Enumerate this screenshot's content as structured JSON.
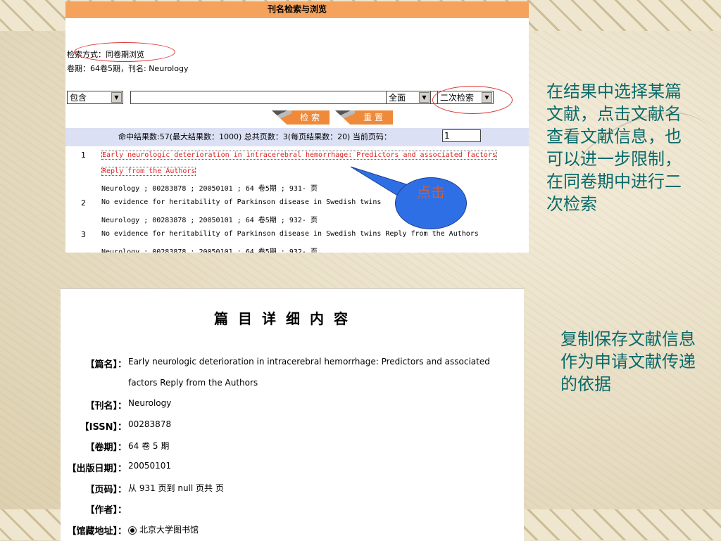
{
  "top_panel": {
    "title": "刊名检索与浏览",
    "search_mode": "检索方式：同卷期浏览",
    "volume_info": "卷期：64卷5期，刊名: Neurology",
    "match_select": "包含",
    "scope_select": "全面",
    "secondary_select": "二次检索",
    "search_button": "检 索",
    "reset_button": "重 置",
    "stats_text": "命中结果数:57(最大结果数：1000)   总共页数：3(每页结果数：20)  当前页码：",
    "page_value": "1",
    "results": [
      {
        "num": "1",
        "title_line1": "Early neurologic deterioration in intracerebral hemorrhage: Predictors and associated factors",
        "title_line2": "Reply from the Authors",
        "meta": "Neurology ; 00283878 ; 20050101 ; 64 卷5期 ; 931- 页"
      },
      {
        "num": "2",
        "title_line1": "No evidence for heritability of Parkinson disease in Swedish twins",
        "meta": "Neurology ; 00283878 ; 20050101 ; 64 卷5期 ; 932- 页"
      },
      {
        "num": "3",
        "title_line1": "No evidence for heritability of Parkinson disease in Swedish twins Reply from the Authors",
        "meta": "Neurology ; 00283878 ; 20050101 ; 64 卷5期 ; 932- 页"
      }
    ],
    "callout_text": "点击"
  },
  "detail_panel": {
    "heading": "篇目详细内容",
    "fields": [
      {
        "label": "【篇名】：",
        "value": "Early neurologic deterioration in intracerebral hemorrhage: Predictors and associated",
        "value2": "factors Reply from the Authors"
      },
      {
        "label": "【刊名】：",
        "value": "Neurology"
      },
      {
        "label": "【ISSN】：",
        "value": "00283878"
      },
      {
        "label": "【卷期】：",
        "value": "64 卷 5 期"
      },
      {
        "label": "【出版日期】：",
        "value": "20050101"
      },
      {
        "label": "【页码】：",
        "value": "从 931 页到 null 页共 页"
      },
      {
        "label": "【作者】：",
        "value": ""
      },
      {
        "label": "【馆藏地址】：",
        "value": "北京大学图书馆"
      }
    ]
  },
  "notes": {
    "note1": "在结果中选择某篇文献，点击文献名查看文献信息，也可以进一步限制，在同卷期中进行二次检索",
    "note2": "复制保存文献信息作为申请文献传递的依据"
  },
  "colors": {
    "note_text": "#0a6a6a",
    "title_bar": "#f5a25d",
    "button": "#ee8a3a",
    "stats_bar": "#dce0f5",
    "link_red": "#d22",
    "callout": "#2f6fe6"
  }
}
